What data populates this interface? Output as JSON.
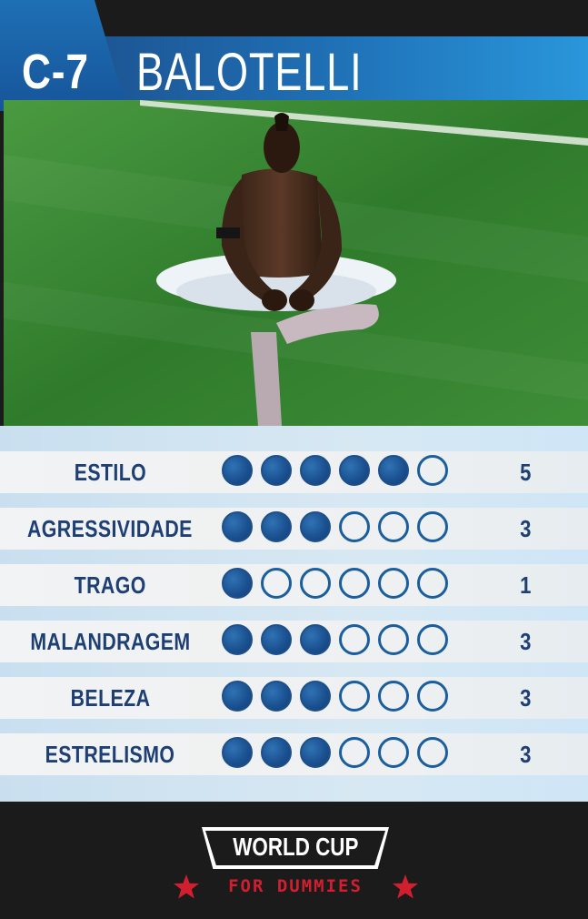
{
  "card": {
    "code": "C-7",
    "player_name": "BALOTELLI"
  },
  "stats": [
    {
      "label": "ESTILO",
      "value": "5",
      "rating": 5,
      "max": 6
    },
    {
      "label": "AGRESSIVIDADE",
      "value": "3",
      "rating": 3,
      "max": 6
    },
    {
      "label": "TRAGO",
      "value": "1",
      "rating": 1,
      "max": 6
    },
    {
      "label": "MALANDRAGEM",
      "value": "3",
      "rating": 3,
      "max": 6
    },
    {
      "label": "BELEZA",
      "value": "3",
      "rating": 3,
      "max": 6
    },
    {
      "label": "ESTRELISMO",
      "value": "3",
      "rating": 3,
      "max": 6
    }
  ],
  "logo": {
    "title": "WORLD CUP",
    "subtitle": "FOR DUMMIES",
    "star_icon": "star-icon"
  },
  "colors": {
    "header_blue": "#1f6fb4",
    "dot_blue": "#1a4f8e",
    "label_navy": "#1e3f73",
    "star_red": "#d11f2f",
    "background_dark": "#1b1b1b"
  }
}
